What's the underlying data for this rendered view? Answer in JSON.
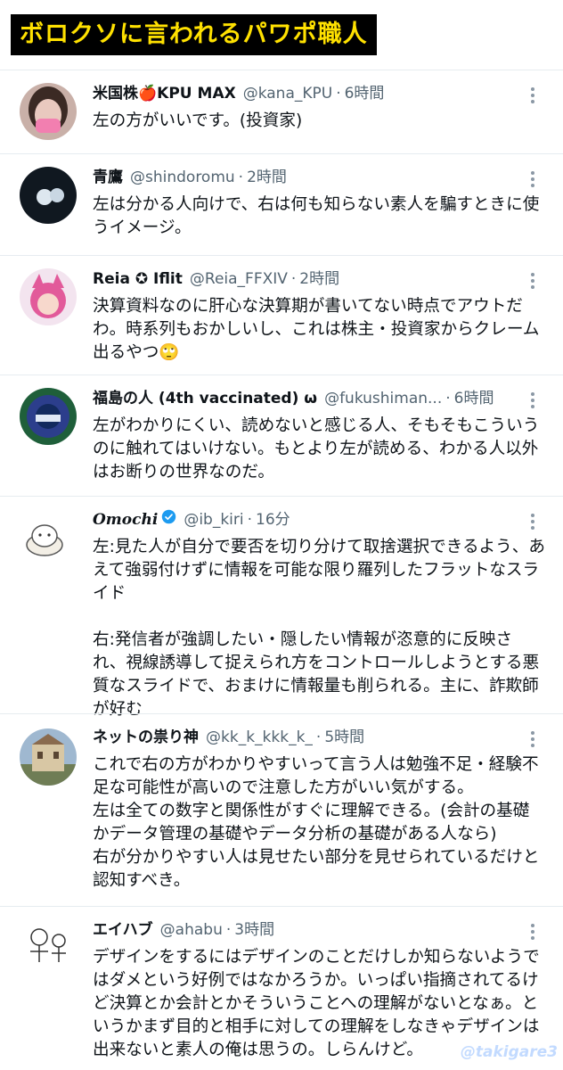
{
  "banner": {
    "title": "ボロクソに言われるパワポ職人"
  },
  "tweets": [
    {
      "name": "米国株🍎KPU MAX",
      "handle": "@kana_KPU",
      "time": "6時間",
      "text": "左の方がいいです。(投資家)"
    },
    {
      "name": "青鷹",
      "handle": "@shindoromu",
      "time": "2時間",
      "text": "左は分かる人向けで、右は何も知らない素人を騙すときに使うイメージ。"
    },
    {
      "name": "Reia ✪ Iflit",
      "handle": "@Reia_FFXIV",
      "time": "2時間",
      "text": "決算資料なのに肝心な決算期が書いてない時点でアウトだわ。時系列もおかしいし、これは株主・投資家からクレーム出るやつ🙄"
    },
    {
      "name": "福島の人 (4th vaccinated) ω",
      "handle": "@fukushiman...",
      "time": "6時間",
      "text": "左がわかりにくい、読めないと感じる人、そもそもこういうのに触れてはいけない。もとより左が読める、わかる人以外はお断りの世界なのだ。"
    },
    {
      "name": "Omochi",
      "handle": "@ib_kiri",
      "time": "16分",
      "text": "左:見た人が自分で要否を切り分けて取捨選択できるよう、あえて強弱付けずに情報を可能な限り羅列したフラットなスライド\n\n右:発信者が強調したい・隠したい情報が恣意的に反映され、視線誘導して捉えられ方をコントロールしようとする悪質なスライドで、おまけに情報量も削られる。主に、詐欺師が好む"
    },
    {
      "name": "ネットの祟り神",
      "handle": "@kk_k_kkk_k_",
      "time": "5時間",
      "text": "これで右の方がわかりやすいって言う人は勉強不足・経験不足な可能性が高いので注意した方がいい気がする。\n左は全ての数字と関係性がすぐに理解できる。(会計の基礎かデータ管理の基礎やデータ分析の基礎がある人なら)\n右が分かりやすい人は見せたい部分を見せられているだけと認知すべき。"
    },
    {
      "name": "エイハブ",
      "handle": "@ahabu",
      "time": "3時間",
      "text": "デザインをするにはデザインのことだけしか知らないようではダメという好例ではなかろうか。いっぱい指摘されてるけど決算とか会計とかそういうことへの理解がないとなぁ。というかまず目的と相手に対しての理解をしなきゃデザインは出来ないと素人の俺は思うの。しらんけど。"
    }
  ],
  "separator": "·",
  "watermark": "@takigare3",
  "colors": {
    "accent": "#1d9bf0",
    "banner_bg": "#000000",
    "banner_text": "#ffe100"
  }
}
